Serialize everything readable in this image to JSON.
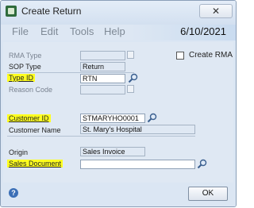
{
  "window": {
    "title": "Create Return",
    "close_glyph": "✕",
    "app_icon": "gp-app-icon"
  },
  "menu": {
    "items": [
      "File",
      "Edit",
      "Tools",
      "Help"
    ],
    "date": "6/10/2021"
  },
  "form": {
    "rma_type": {
      "label": "RMA Type",
      "value": ""
    },
    "create_rma": {
      "label": "Create RMA",
      "checked": false
    },
    "sop_type": {
      "label": "SOP Type",
      "value": "Return"
    },
    "type_id": {
      "label": "Type ID",
      "value": "RTN"
    },
    "reason_code": {
      "label": "Reason Code",
      "value": ""
    },
    "customer_id": {
      "label": "Customer ID",
      "value": "STMARYHO0001"
    },
    "customer_name": {
      "label": "Customer Name",
      "value": "St. Mary's Hospital"
    },
    "origin": {
      "label": "Origin",
      "value": "Sales Invoice"
    },
    "sales_document": {
      "label": "Sales Document",
      "value": ""
    }
  },
  "footer": {
    "help_glyph": "?",
    "ok_label": "OK"
  },
  "highlight_color": "#ffff20"
}
